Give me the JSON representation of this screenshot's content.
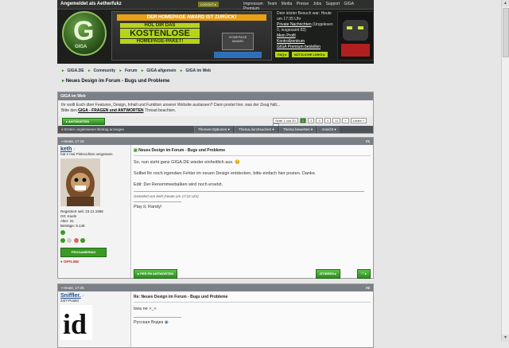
{
  "colors": {
    "accent_green": "#3a9a24",
    "header_dark": "#1d1f1d",
    "bar_gray": "#7b8087",
    "banner_lime": "#b7d41a"
  },
  "header": {
    "login_text": "Angemeldet als Aetherfukz",
    "logout_label": "LOGOUT ▸",
    "nav": [
      "Impressum",
      "Team",
      "Media",
      "Presse",
      "Jobs",
      "Support",
      "GIGA Premium"
    ],
    "logo_text": "GIGA",
    "banner": {
      "award": "DER HOMEPAGE AWARD IST ZURÜCK!",
      "line1": "HOL DIR DAS",
      "line2": "KOSTENLOSE",
      "line3": "HOMEPAGE-PAKET!",
      "award_box": "HOMEPAGE AWARD"
    },
    "info": {
      "last_visit": "Dein letzter Besuch war: Heute um 17:35 Uhr",
      "pm": "Private Nachrichten",
      "pm_status": "(Ungelesen 0, insgesamt 83)",
      "profile": "Mein Profil",
      "control": "Kontrollzentrum",
      "premium": "GIGA Premium bestellen"
    },
    "buttons": [
      "FAQ ▸",
      "NÜTZLICHE LINKS ▸"
    ]
  },
  "breadcrumbs": [
    "GIGA.DE",
    "Community",
    "Forum",
    "GIGA allgemein",
    "GIGA im Web"
  ],
  "thread_title": "Neues Design im Forum - Bugs und Probleme",
  "forum_box": {
    "title": "GIGA im Web",
    "desc1": "Ihr wollt Euch über Features, Design, Inhalt und Funktion unserer Website auslassen? Dann postet hier, was der Zeug hält...",
    "desc2_prefix": "Bitte den",
    "desc2_link": "GIGA - FRAGEN und ANTWORTEN",
    "desc2_suffix": "Thread beachten.",
    "answer_button": "▸ ANTWORTEN",
    "pager": {
      "label": "Seite 1 von 20",
      "pages": [
        "1",
        "2",
        "3",
        "4",
        "11",
        "»",
        "Letzte »",
        "▾"
      ],
      "current": "1"
    },
    "new_post_link": "Ersten ungelesenen Beitrag anzeigen",
    "tools": [
      "Themen-Optionen ▾",
      "Thema durchsuchen ▾",
      "Thema bewerten ▾",
      "Ansicht ▾"
    ]
  },
  "posts": [
    {
      "date": "Heute, 17:16",
      "number": "#1",
      "user": {
        "name": "keth",
        "title": "hat 2 mal Pinkrochten vergessen",
        "reg": "Registriert seit: 23.12.1988",
        "ort": "Ort: Koeln",
        "alter": "Alter: 31",
        "beitraege": "Beiträge: 9.148",
        "badge": "PROGAMERING",
        "status": "OFFLINE"
      },
      "title": "Neues Design im Forum - Bugs und Probleme",
      "lines": [
        "So, nun sieht ganz GIGA.DE wieder einheitlich aus. 😊",
        "Solltet Ihr noch irgendwo Fehler im neuen Design entdecken, bitte einfach hier posten. Danke.",
        "Edit: Der Renommeebalken wird noch ersetzt."
      ],
      "edit": "Geändert von keth (Heute um 17:22 Uhr)",
      "signature": "Play it, Randy!",
      "buttons": {
        "pn": "▸ PER PN ANTWORTEN",
        "quote": "ZITIEREN ▸",
        "multi": "\"\" ▸"
      }
    },
    {
      "date": "Heute, 17:26",
      "number": "#2",
      "user": {
        "name": "Sniffler.",
        "title": "24/7-Poster"
      },
      "title": "Re: Neues Design im Forum - Bugs und Probleme",
      "lines": [
        "bwa ne >_<"
      ],
      "signature": "Русская Водка"
    }
  ]
}
